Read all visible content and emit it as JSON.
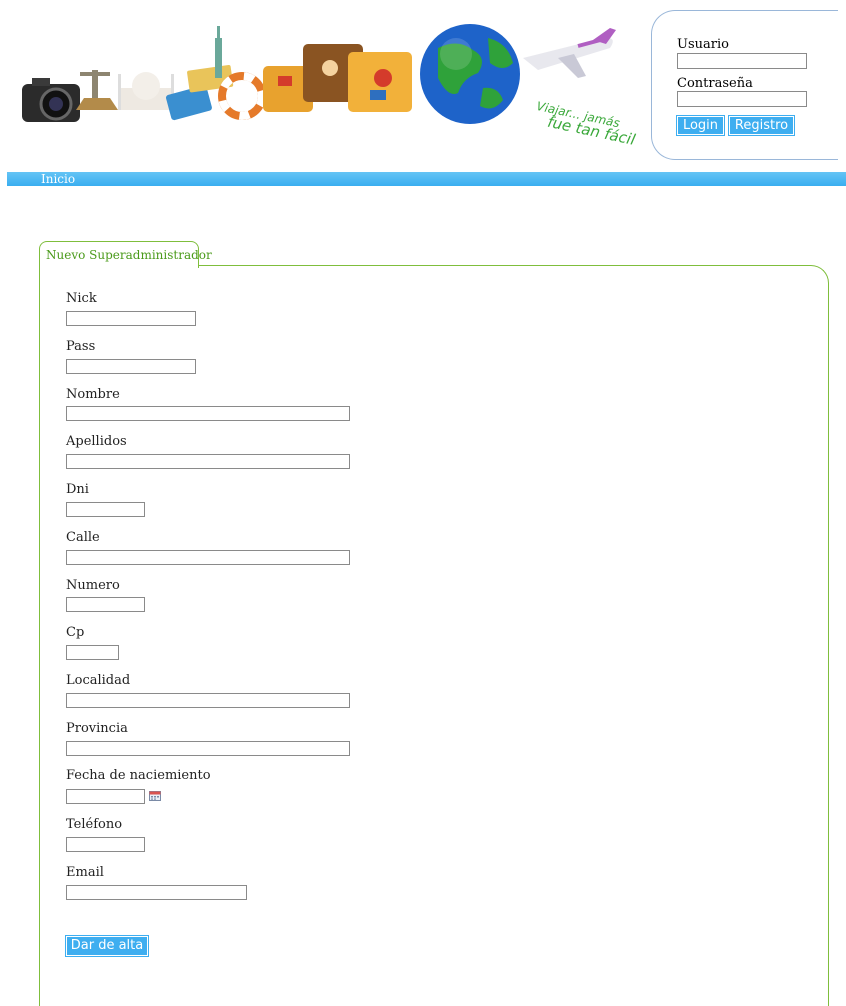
{
  "header": {
    "tagline_line1": "Viajar... jamás",
    "tagline_line2": "fue tan fácil"
  },
  "login": {
    "user_label": "Usuario",
    "password_label": "Contraseña",
    "user_value": "",
    "password_value": "",
    "login_button": "Login",
    "register_button": "Registro"
  },
  "nav": {
    "home": "Inicio"
  },
  "form": {
    "tab_title": "Nuevo Superadministrador",
    "fields": {
      "nick": "Nick",
      "pass": "Pass",
      "nombre": "Nombre",
      "apellidos": "Apellidos",
      "dni": "Dni",
      "calle": "Calle",
      "numero": "Numero",
      "cp": "Cp",
      "localidad": "Localidad",
      "provincia": "Provincia",
      "fecha": "Fecha de naciemiento",
      "telefono": "Teléfono",
      "email": "Email"
    },
    "submit": "Dar de alta"
  },
  "colors": {
    "accent_blue": "#3eaef0",
    "panel_green": "#7fbe3c",
    "login_border": "#9ab7d9"
  }
}
